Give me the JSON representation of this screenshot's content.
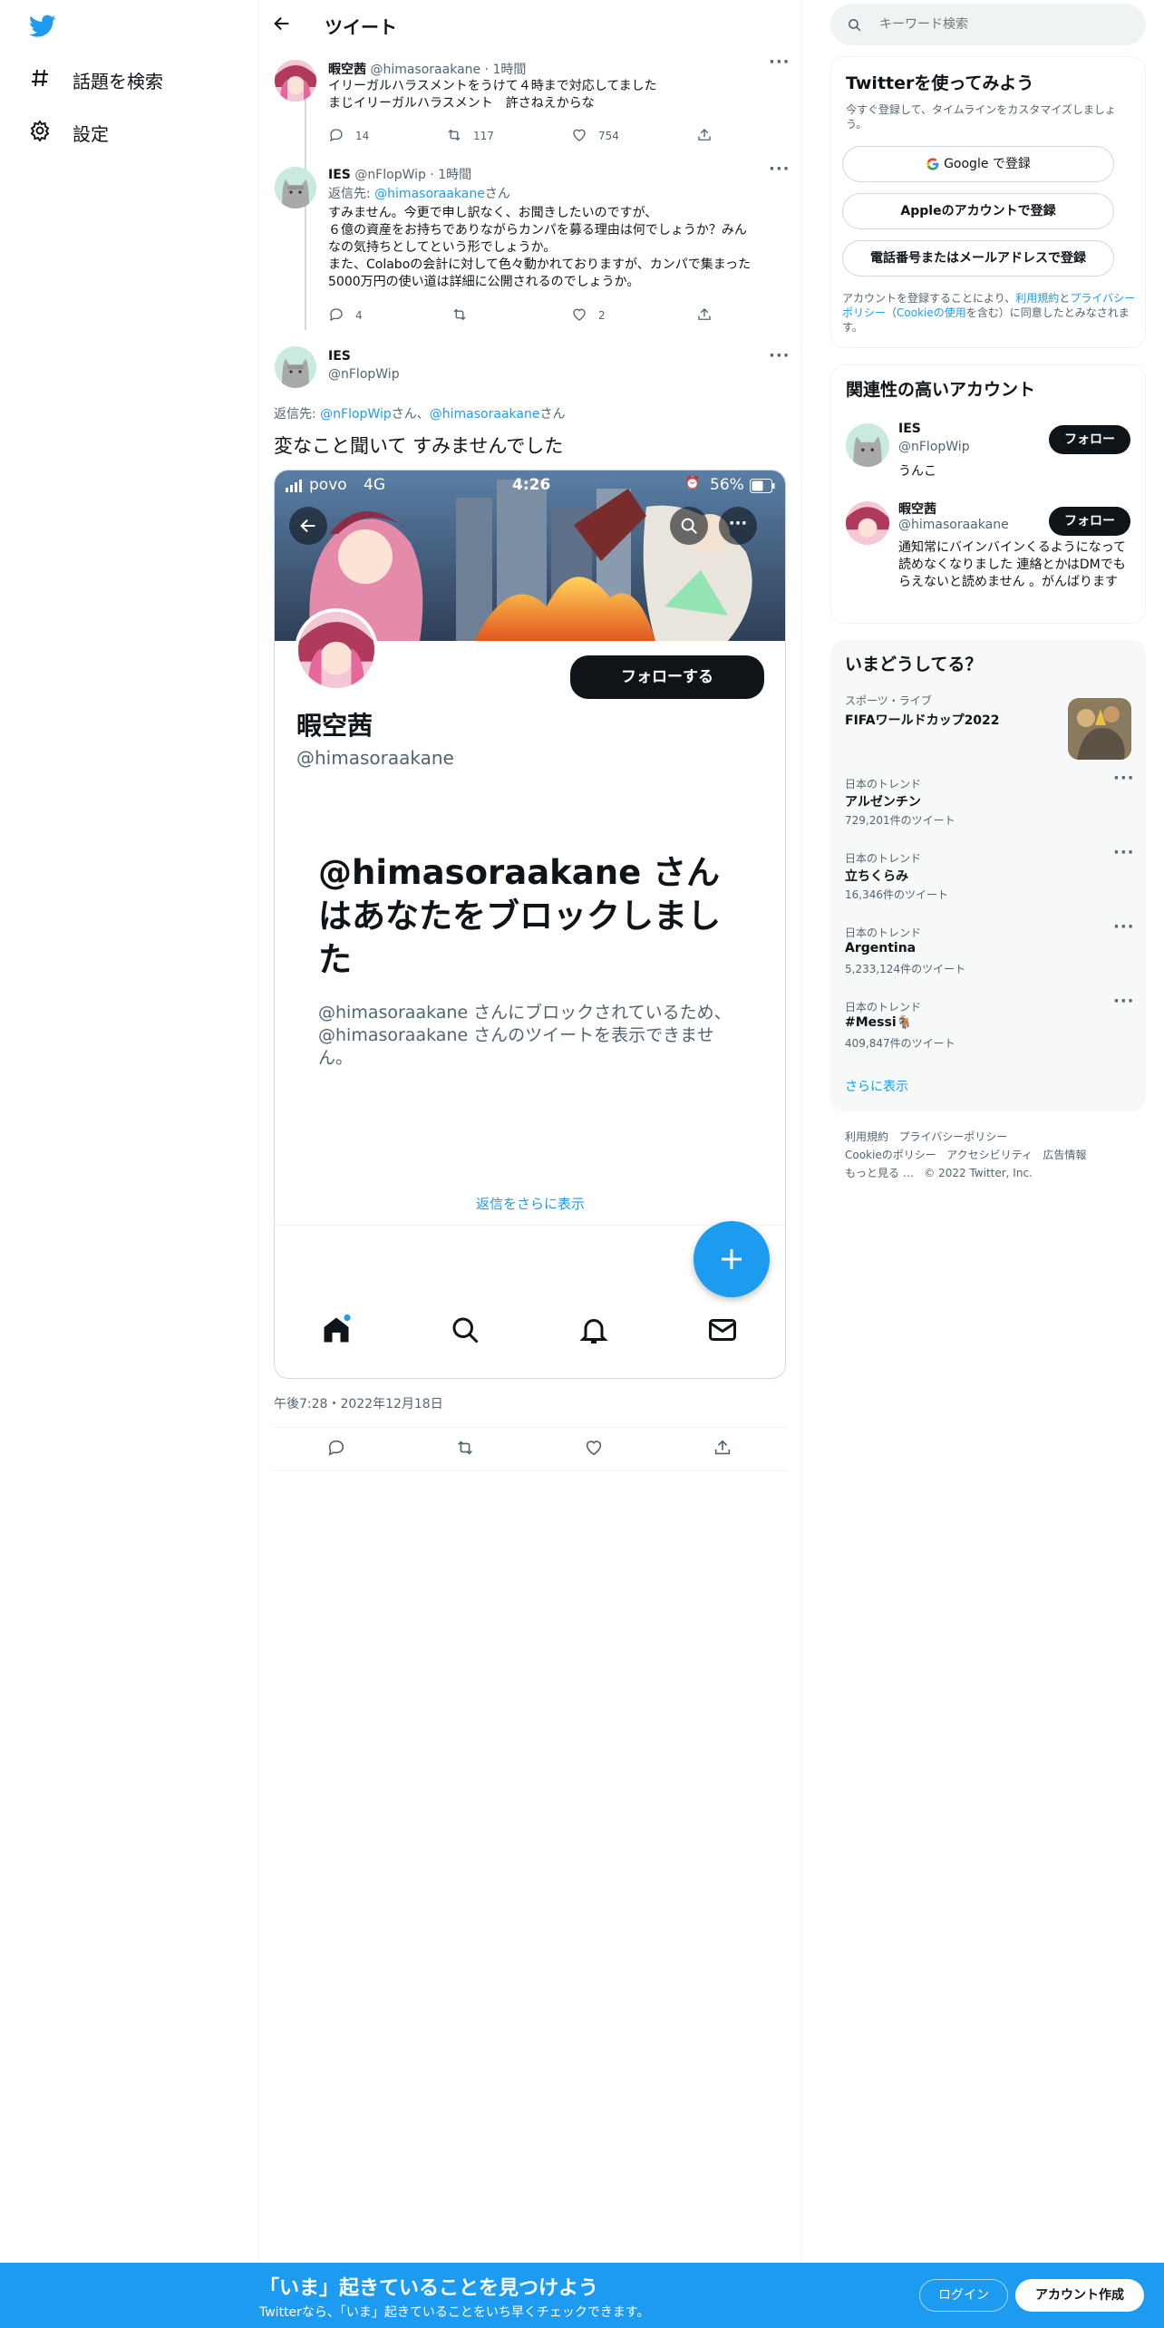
{
  "sidebar": {
    "logo": "twitter-bird",
    "items": [
      {
        "icon": "hashtag-icon",
        "label": "話題を検索"
      },
      {
        "icon": "gear-icon",
        "label": "設定"
      }
    ]
  },
  "header": {
    "title": "ツイート"
  },
  "tweets": [
    {
      "name": "暇空茜",
      "handle": "@himasoraakane",
      "time": "1時間",
      "lines": [
        "イリーガルハラスメントをうけて４時まで対応してました",
        "まじイリーガルハラスメント　許さねえからな"
      ],
      "replies": "14",
      "retweets": "117",
      "likes": "754"
    },
    {
      "name": "IES",
      "handle": "@nFlopWip",
      "time": "1時間",
      "reply_prefix": "返信先: ",
      "reply_to": "@himasoraakane",
      "reply_suffix": "さん",
      "lines": [
        "すみません。今更で申し訳なく、お聞きしたいのですが、",
        "６億の資産をお持ちでありながらカンパを募る理由は何でしょうか？みん",
        "なの気持ちとしてという形でしょうか。",
        "また、Colaboの会計に対して色々動かれておりますが、カンパで集まった",
        "5000万円の使い道は詳細に公開されるのでしょうか。"
      ],
      "replies": "4",
      "retweets": "",
      "likes": "2"
    }
  ],
  "main_tweet": {
    "name": "IES",
    "handle": "@nFlopWip",
    "reply_prefix": "返信先: ",
    "reply_to1": "@nFlopWip",
    "reply_mid": "さん、",
    "reply_to2": "@himasoraakane",
    "reply_suffix": "さん",
    "text": "変なこと聞いて すみませんでした",
    "timestamp": "午後7:28・2022年12月18日"
  },
  "embedded_screenshot": {
    "carrier": "povo",
    "network": "4G",
    "clock": "4:26",
    "battery": "56%",
    "follow_button": "フォローする",
    "profile_name": "暇空茜",
    "profile_handle": "@himasoraakane",
    "blocked_title": "@himasoraakane さんはあなたをブロックしました",
    "blocked_body": "@himasoraakane さんにブロックされているため、@himasoraakane さんのツイートを表示できません。",
    "show_more_replies": "返信をさらに表示"
  },
  "search": {
    "placeholder": "キーワード検索"
  },
  "signup": {
    "title": "Twitterを使ってみよう",
    "subtitle": "今すぐ登録して、タイムラインをカスタマイズしましょう。",
    "google": "Google で登録",
    "apple": "Appleのアカウントで登録",
    "phone": "電話番号またはメールアドレスで登録",
    "legal_1": "アカウントを登録することにより、",
    "legal_link1": "利用規約",
    "legal_2": "と",
    "legal_link2": "プライバシーポリシー",
    "legal_3": "（",
    "legal_link3": "Cookieの使用",
    "legal_4": "を含む）に同意したとみなされます。"
  },
  "relevant": {
    "title": "関連性の高いアカウント",
    "accounts": [
      {
        "name": "IES",
        "handle": "@nFlopWip",
        "bio": "うんこ",
        "button": "フォロー"
      },
      {
        "name": "暇空茜",
        "handle": "@himasoraakane",
        "bio": "通知常にバインバインくるようになって読めなくなりました 連絡とかはDMでもらえないと読めません 。がんばります",
        "button": "フォロー"
      }
    ]
  },
  "trends": {
    "title": "いまどうしてる？",
    "featured": {
      "category": "スポーツ・ライブ",
      "name": "FIFAワールドカップ2022"
    },
    "items": [
      {
        "category": "日本のトレンド",
        "name": "アルゼンチン",
        "count": "729,201件のツイート"
      },
      {
        "category": "日本のトレンド",
        "name": "立ちくらみ",
        "count": "16,346件のツイート"
      },
      {
        "category": "日本のトレンド",
        "name": "Argentina",
        "count": "5,233,124件のツイート"
      },
      {
        "category": "日本のトレンド",
        "name": "#Messi🐐",
        "count": "409,847件のツイート"
      }
    ],
    "show_more": "さらに表示"
  },
  "footer_links": {
    "line1": [
      "利用規約",
      "プライバシーポリシー"
    ],
    "line2": [
      "Cookieのポリシー",
      "アクセシビリティ",
      "広告情報"
    ],
    "line3": [
      "もっと見る …",
      "© 2022 Twitter, Inc."
    ]
  },
  "bottom_bar": {
    "title": "「いま」起きていることを見つけよう",
    "subtitle": "Twitterなら、「いま」起きていることをいち早くチェックできます。",
    "login": "ログイン",
    "signup": "アカウント作成"
  },
  "colors": {
    "accent": "#1d9bf0",
    "bottom_bar": "#1d9bf0",
    "text": "#0f1419",
    "muted": "#536471"
  }
}
